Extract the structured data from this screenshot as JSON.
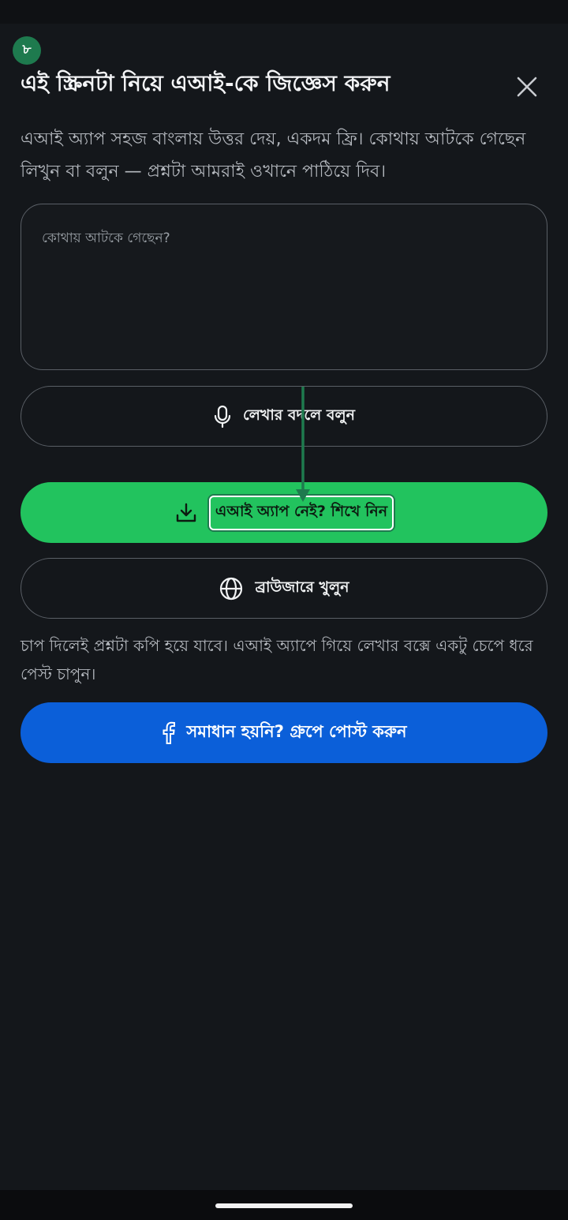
{
  "step_badge": "৮",
  "dialog": {
    "title": "এই স্ক্রিনটা নিয়ে এআই-কে জিজ্ঞেস করুন",
    "description": "এআই অ্যাপ সহজ বাংলায় উত্তর দেয়, একদম ফ্রি। কোথায় আটকে গেছেন লিখুন বা বলুন — প্রশ্নটা আমরাই ওখানে পাঠিয়ে দিব।",
    "input": {
      "placeholder": "কোথায় আটকে গেছেন?",
      "value": ""
    },
    "voice_button": {
      "label": "লেখার বদলে বলুন",
      "icon": "microphone-icon"
    },
    "learn_button": {
      "label": "এআই অ্যাপ নেই? শিখে নিন",
      "icon": "download-icon"
    },
    "browser_button": {
      "label": "ব্রাউজারে খুলুন",
      "icon": "globe-icon"
    },
    "hint": "চাপ দিলেই প্রশ্নটা কপি হয়ে যাবে। এআই অ্যাপে গিয়ে লেখার বক্সে একটু চেপে ধরে পেস্ট চাপুন।",
    "group_button": {
      "label": "সমাধান হয়নি? গ্রুপে পোস্ট করুন",
      "icon": "facebook-icon"
    }
  },
  "colors": {
    "background": "#14171b",
    "accent_green": "#22c35e",
    "badge_green": "#1e7a4e",
    "facebook_blue": "#0b5fd9"
  }
}
